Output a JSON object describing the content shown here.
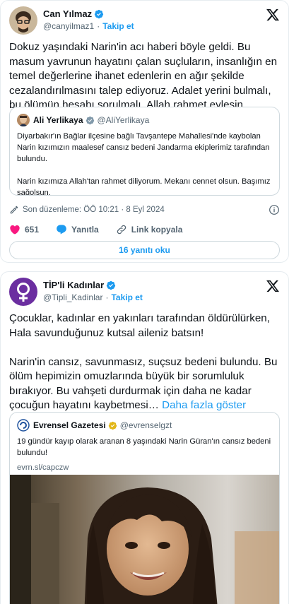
{
  "tweet1": {
    "author_name": "Can Yılmaz",
    "author_handle": "@canyilmaz1",
    "follow_label": "Takip et",
    "separator": "·",
    "text": "Dokuz yaşındaki Narin'in acı haberi böyle geldi. Bu masum yavrunun hayatını çalan suçluların, insanlığın en temel değerlerine ihanet edenlerin en ağır şekilde cezalandırılmasını talep ediyoruz. Adalet yerini bulmalı, bu ölümün hesabı sorulmalı. Allah rahmet eylesin.",
    "quote": {
      "author_name": "Ali Yerlikaya",
      "author_handle": "@AliYerlikaya",
      "text": "Diyarbakır'ın Bağlar ilçesine bağlı Tavşantepe Mahallesi'nde kaybolan Narin kızımızın maalesef cansız bedeni Jandarma ekiplerimiz tarafından bulundu.\n\nNarin kızımıza Allah'tan rahmet diliyorum. Mekanı cennet olsun. Başımız sağolsun."
    },
    "edited_label": "Son düzenleme: ÖÖ 10:21 · 8 Eyl 2024",
    "likes_count": "651",
    "reply_label": "Yanıtla",
    "copy_link_label": "Link kopyala",
    "read_replies_label": "16 yanıtı oku",
    "icons": {
      "verified": "verified-badge-icon",
      "x": "x-logo-icon",
      "edit": "pencil-icon",
      "info": "info-icon",
      "like": "heart-icon",
      "reply": "speech-bubble-icon",
      "link": "link-icon"
    }
  },
  "tweet2": {
    "author_name": "TİP'li Kadınlar",
    "author_handle": "@Tipli_Kadinlar",
    "follow_label": "Takip et",
    "separator": "·",
    "text_part1": "Çocuklar, kadınlar en yakınları tarafından öldürülürken, Hala savunduğunuz kutsal aileniz batsın!\n\nNarin'in cansız, savunmasız, suçsuz bedeni bulundu. Bu ölüm hepimizin omuzlarında büyük bir sorumluluk bırakıyor. Bu vahşeti durdurmak için daha ne kadar çocuğun hayatını kaybetmesi… ",
    "show_more_label": "Daha fazla göster",
    "quote": {
      "author_name": "Evrensel Gazetesi",
      "author_handle": "@evrenselgzt",
      "text": "19 gündür kayıp olarak aranan 8 yaşındaki Narin Güran'ın cansız bedeni bulundu!",
      "link": "evrn.sl/capczw"
    }
  },
  "colors": {
    "accent": "#1d9bf0",
    "like": "#f91880",
    "muted": "#536471",
    "text": "#0f1419",
    "border": "#cfd9de",
    "tip_purple": "#6b2ea0"
  }
}
